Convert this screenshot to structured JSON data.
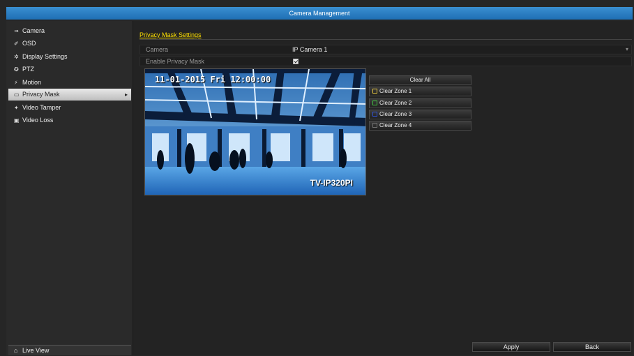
{
  "window": {
    "title": "Camera Management"
  },
  "sidebar": {
    "items": [
      {
        "label": "Camera",
        "icon": "camera-icon",
        "glyph": "➟"
      },
      {
        "label": "OSD",
        "icon": "osd-icon",
        "glyph": "✐"
      },
      {
        "label": "Display Settings",
        "icon": "display-settings-icon",
        "glyph": "✲"
      },
      {
        "label": "PTZ",
        "icon": "ptz-icon",
        "glyph": "✪"
      },
      {
        "label": "Motion",
        "icon": "motion-icon",
        "glyph": "⚡"
      },
      {
        "label": "Privacy Mask",
        "icon": "privacy-mask-icon",
        "glyph": "▭",
        "active": true
      },
      {
        "label": "Video Tamper",
        "icon": "video-tamper-icon",
        "glyph": "✦"
      },
      {
        "label": "Video Loss",
        "icon": "video-loss-icon",
        "glyph": "▣"
      }
    ],
    "live_view": {
      "label": "Live View",
      "glyph": "⌂"
    }
  },
  "privacy": {
    "section_title": "Privacy Mask Settings",
    "camera": {
      "label": "Camera",
      "value": "IP Camera 1"
    },
    "enable": {
      "label": "Enable Privacy Mask",
      "checked": true
    }
  },
  "preview": {
    "osd_time": "11-01-2015 Fri 12:00:00",
    "osd_name": "TV-IP320PI"
  },
  "zones": {
    "clear_all": "Clear All",
    "items": [
      {
        "label": "Clear Zone 1",
        "color": "#e0c040"
      },
      {
        "label": "Clear Zone 2",
        "color": "#40c040"
      },
      {
        "label": "Clear Zone 3",
        "color": "#3050d0"
      },
      {
        "label": "Clear Zone 4",
        "color": "#707070"
      }
    ]
  },
  "footer": {
    "apply": "Apply",
    "back": "Back"
  }
}
